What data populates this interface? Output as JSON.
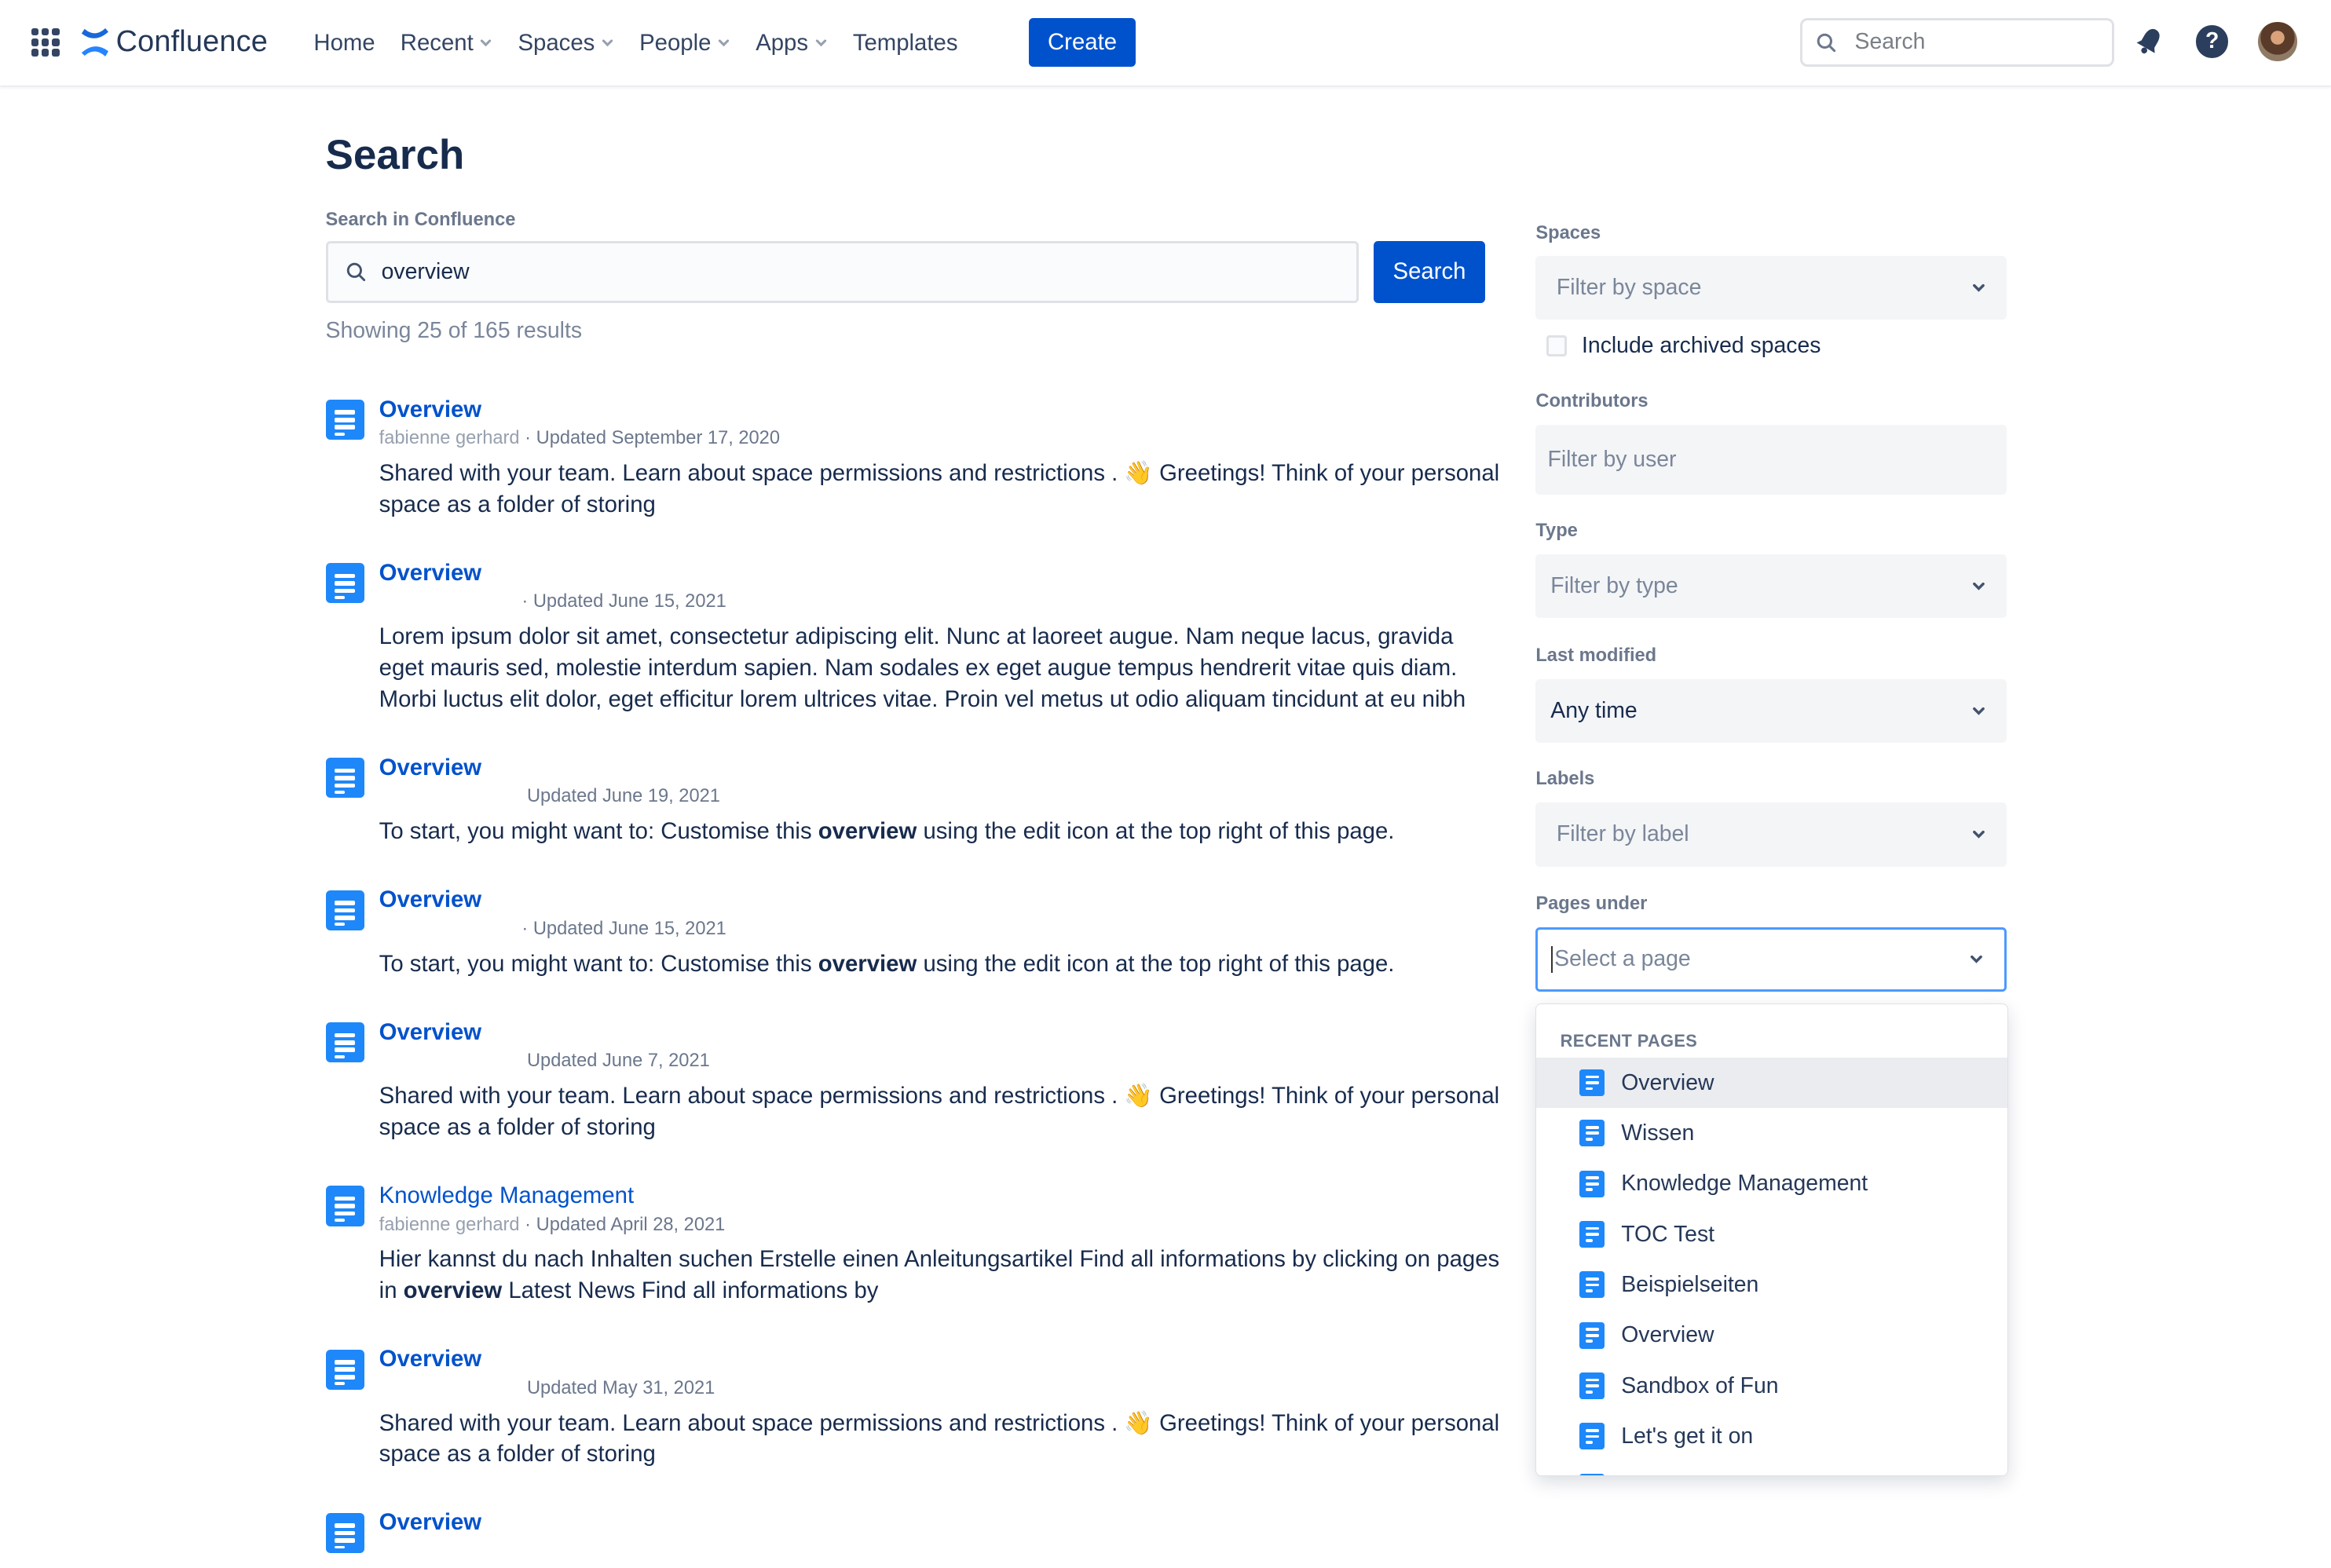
{
  "app": {
    "name": "Confluence"
  },
  "nav": {
    "items": [
      {
        "label": "Home",
        "dropdown": false
      },
      {
        "label": "Recent",
        "dropdown": true
      },
      {
        "label": "Spaces",
        "dropdown": true
      },
      {
        "label": "People",
        "dropdown": true
      },
      {
        "label": "Apps",
        "dropdown": true
      },
      {
        "label": "Templates",
        "dropdown": false
      }
    ],
    "create_label": "Create",
    "search_placeholder": "Search",
    "icons": [
      "app-switcher-icon",
      "notifications-bell-icon",
      "help-icon",
      "user-avatar"
    ]
  },
  "main": {
    "title": "Search",
    "search_label": "Search in Confluence",
    "search_value": "overview",
    "search_button": "Search",
    "result_count": "Showing 25 of 165 results",
    "results": [
      {
        "title": "Overview",
        "author": "fabienne gerhard",
        "sep": "·",
        "updated": "Updated September 17, 2020",
        "excerpt": [
          "Shared with your team. Learn about space permissions and restrictions . 👋 Greetings! Think of your personal space as a folder of storing"
        ]
      },
      {
        "title": "Overview",
        "author": "",
        "sep": "·",
        "updated": "Updated June 15, 2021",
        "excerpt": [
          "Lorem ipsum dolor sit amet, consectetur adipiscing elit. Nunc at laoreet augue. Nam neque lacus, gravida eget mauris sed, molestie interdum sapien. Nam sodales ex eget augue tempus hendrerit vitae quis diam. Morbi luctus elit dolor, eget efficitur lorem ultrices vitae. Proin vel metus ut odio aliquam tincidunt at eu nibh"
        ]
      },
      {
        "title": "Overview",
        "author": "",
        "sep": "",
        "updated": "Updated June 19, 2021",
        "excerpt": [
          "To start, you might want to: Customise this ",
          "overview",
          " using the edit icon at the top right of this page."
        ]
      },
      {
        "title": "Overview",
        "author": "",
        "sep": "·",
        "updated": "Updated June 15, 2021",
        "excerpt": [
          "To start, you might want to: Customise this ",
          "overview",
          " using the edit icon at the top right of this page."
        ]
      },
      {
        "title": "Overview",
        "author": "",
        "sep": "",
        "updated": "Updated June 7, 2021",
        "excerpt": [
          "Shared with your team. Learn about space permissions and restrictions . 👋 Greetings! Think of your personal space as a folder of storing"
        ]
      },
      {
        "title": "Knowledge Management",
        "author": "fabienne gerhard",
        "sep": "·",
        "updated": "Updated April 28, 2021",
        "excerpt": [
          "Hier kannst du nach Inhalten suchen Erstelle einen Anleitungsartikel Find all informations by clicking on pages in ",
          "overview",
          " Latest News Find all informations by"
        ]
      },
      {
        "title": "Overview",
        "author": "",
        "sep": "",
        "updated": "Updated May 31, 2021",
        "excerpt": [
          "Shared with your team. Learn about space permissions and restrictions . 👋 Greetings! Think of your personal space as a folder of storing"
        ]
      },
      {
        "title": "Overview",
        "author": "",
        "sep": "",
        "updated": "",
        "excerpt": [
          ""
        ]
      }
    ]
  },
  "filters": {
    "spaces": {
      "label": "Spaces",
      "placeholder": "Filter by space"
    },
    "archived": {
      "label": "Include archived spaces",
      "checked": false
    },
    "contributors": {
      "label": "Contributors",
      "placeholder": "Filter by user"
    },
    "type": {
      "label": "Type",
      "placeholder": "Filter by type"
    },
    "last_modified": {
      "label": "Last modified",
      "value": "Any time"
    },
    "labels": {
      "label": "Labels",
      "placeholder": "Filter by label"
    },
    "pages_under": {
      "label": "Pages under",
      "placeholder": "Select a page"
    }
  },
  "dropdown": {
    "heading": "RECENT PAGES",
    "items": [
      "Overview",
      "Wissen",
      "Knowledge Management",
      "TOC Test",
      "Beispielseiten",
      "Overview",
      "Sandbox of Fun",
      "Let's get it on"
    ]
  },
  "colors": {
    "brand": "#0052cc",
    "page_icon": "#1e88fa",
    "focus": "#4c9aff"
  }
}
